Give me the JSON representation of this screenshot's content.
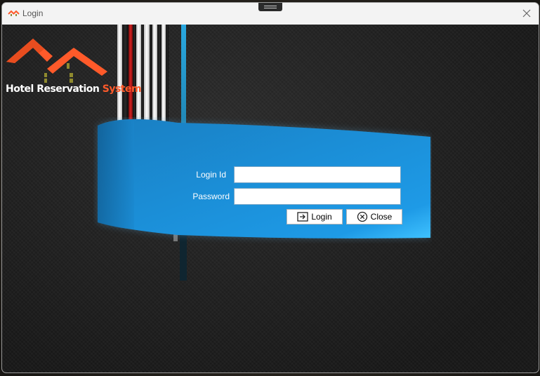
{
  "window": {
    "title": "Login",
    "title_icon": "hotel-app-icon",
    "close_icon": "close-icon"
  },
  "logo": {
    "text_hotel": "Hotel Reservation",
    "text_system": "System",
    "accent_color": "#ff5a2a"
  },
  "form": {
    "login_id_label": "Login Id",
    "login_id_value": "",
    "password_label": "Password",
    "password_value": "",
    "login_button": "Login",
    "login_icon": "login-arrow-icon",
    "close_button": "Close",
    "close_icon": "circle-x-icon"
  },
  "colors": {
    "banner_blue": "#1a8fd6",
    "background": "#1c1c1c",
    "stripe_red": "#b41a1a",
    "stripe_cyan": "#29a8e0"
  }
}
